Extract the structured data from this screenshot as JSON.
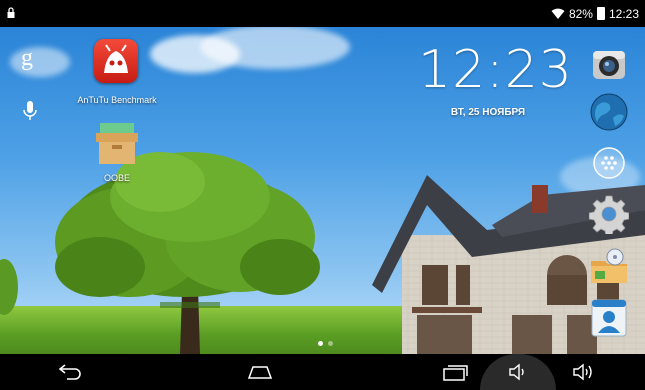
{
  "status_bar": {
    "battery_percent": "82%",
    "time": "12:23",
    "icons": [
      "lock-icon",
      "wifi-icon",
      "battery-icon"
    ]
  },
  "search_widget": {
    "icons": [
      "google-search-icon",
      "microphone-icon"
    ]
  },
  "clock_widget": {
    "time": "12:23",
    "date": "ВТ, 25 НОЯБРЯ"
  },
  "desktop_apps": [
    {
      "label": "AnTuTu Benchmark",
      "icon": "antutu-icon"
    },
    {
      "label": "OOBE",
      "icon": "oobe-box-icon"
    }
  ],
  "right_dock": [
    {
      "icon": "camera-icon"
    },
    {
      "icon": "browser-globe-icon"
    },
    {
      "icon": "all-apps-icon"
    },
    {
      "icon": "settings-gear-icon"
    },
    {
      "icon": "file-manager-icon"
    },
    {
      "icon": "contacts-icon"
    }
  ],
  "page_indicator": {
    "count": 2,
    "current": 1
  },
  "nav_bar": {
    "icons": [
      "back-icon",
      "home-icon",
      "recent-apps-icon",
      "volume-down-icon",
      "volume-up-icon"
    ]
  }
}
